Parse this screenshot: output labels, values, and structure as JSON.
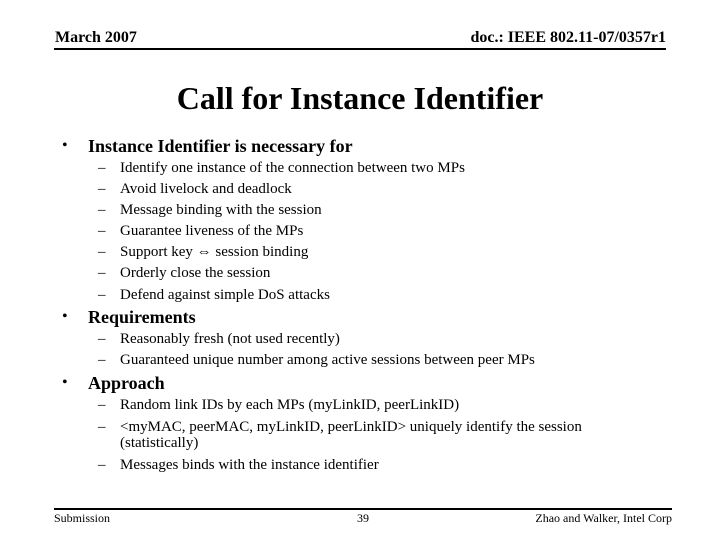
{
  "header": {
    "date": "March 2007",
    "doc_id": "doc.: IEEE 802.11-07/0357r1"
  },
  "title": "Call for Instance Identifier",
  "sections": [
    {
      "heading": "Instance Identifier is necessary for",
      "items": [
        "Identify one instance of the connection between two MPs",
        "Avoid livelock and deadlock",
        "Message binding with the session",
        "Guarantee liveness of the MPs",
        "Support key ⇔ session binding",
        "Orderly close the session",
        "Defend against simple DoS attacks"
      ]
    },
    {
      "heading": "Requirements",
      "items": [
        "Reasonably fresh (not used recently)",
        "Guaranteed unique number among active sessions between peer MPs"
      ]
    },
    {
      "heading": "Approach",
      "items": [
        "Random link IDs by each MPs (myLinkID, peerLinkID)",
        "<myMAC, peerMAC, myLinkID, peerLinkID> uniquely identify the session",
        "(statistically)",
        "Messages binds with the instance identifier"
      ]
    }
  ],
  "symbols": {
    "bullet": "•",
    "dash": "–"
  },
  "footer": {
    "left": "Submission",
    "page_number": "39",
    "right": "Zhao and Walker, Intel Corp"
  }
}
